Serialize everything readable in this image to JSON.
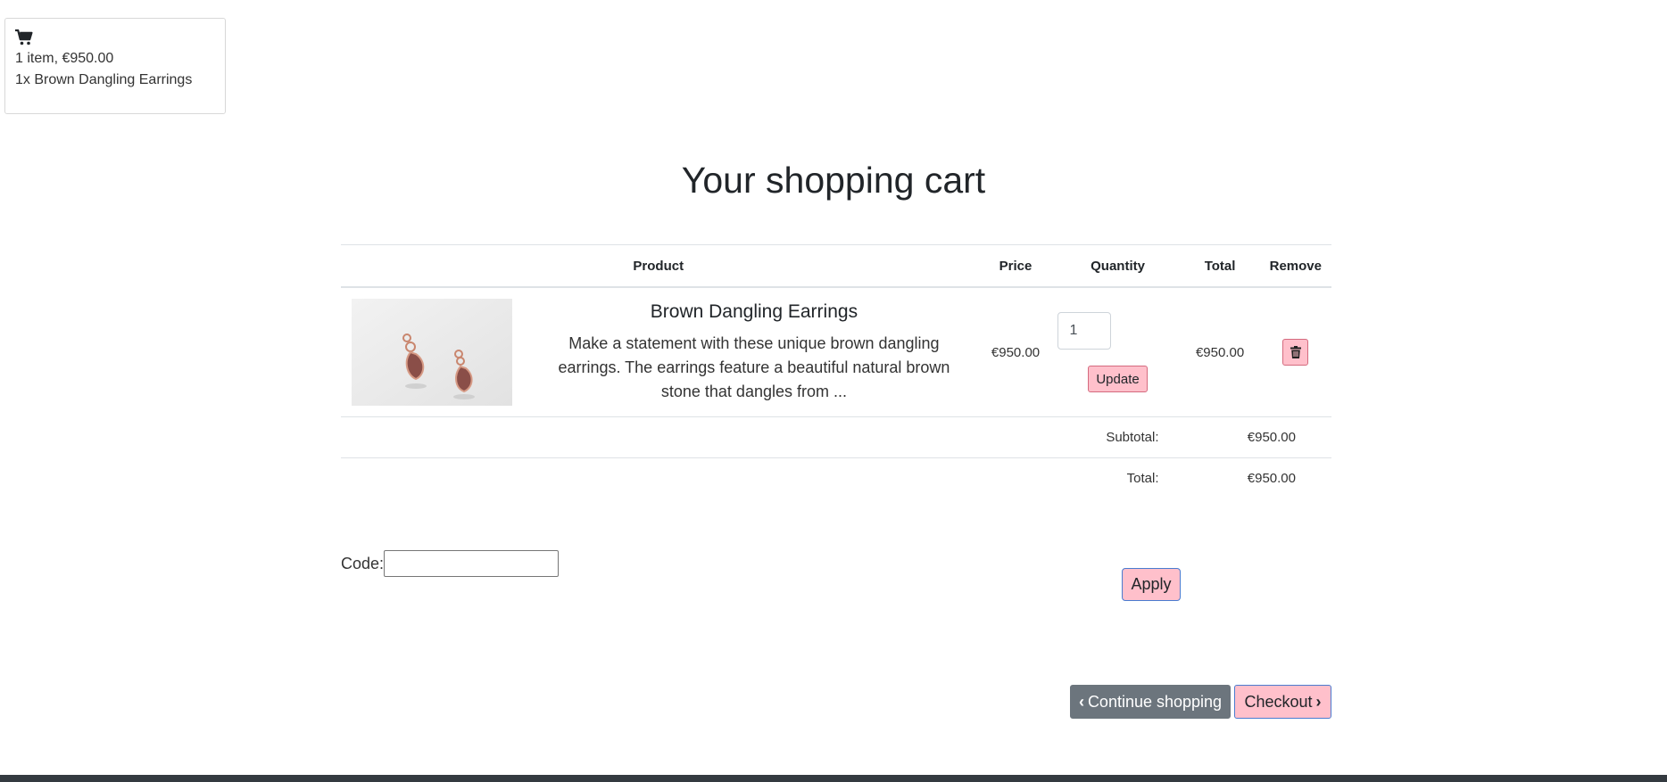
{
  "mini_cart": {
    "icon": "shopping-cart-icon",
    "summary": "1 item, €950.00",
    "items": [
      "1x Brown Dangling Earrings"
    ]
  },
  "page": {
    "title": "Your shopping cart"
  },
  "cart": {
    "columns": [
      "Product",
      "Price",
      "Quantity",
      "Total",
      "Remove"
    ],
    "items": [
      {
        "image_icon": "earrings-product-image",
        "name": "Brown Dangling Earrings",
        "description": "Make a statement with these unique brown dangling earrings. The earrings feature a beautiful natural brown stone that dangles from ...",
        "price": "€950.00",
        "quantity": "1",
        "update_label": "Update",
        "total": "€950.00",
        "remove_icon": "trash-icon"
      }
    ],
    "subtotal_label": "Subtotal:",
    "subtotal": "€950.00",
    "total_label": "Total:",
    "total": "€950.00"
  },
  "coupon": {
    "label": "Code:",
    "value": "",
    "apply_label": "Apply"
  },
  "actions": {
    "continue_label": "Continue shopping",
    "continue_icon": "chevron-left-icon",
    "checkout_label": "Checkout",
    "checkout_icon": "chevron-right-icon"
  },
  "colors": {
    "accent_pink": "#ffc0cb",
    "secondary_gray": "#6c757d",
    "footer_dark": "#343a40"
  }
}
